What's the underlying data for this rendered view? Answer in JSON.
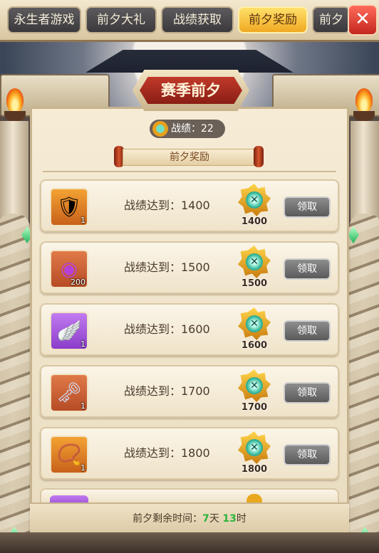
{
  "tabs": [
    {
      "label": "永生者游戏",
      "active": false
    },
    {
      "label": "前夕大礼",
      "active": false
    },
    {
      "label": "战绩获取",
      "active": false
    },
    {
      "label": "前夕奖励",
      "active": true
    },
    {
      "label": "前夕",
      "active": false
    }
  ],
  "close_label": "✕",
  "panel": {
    "title": "赛季前夕",
    "score_label": "战绩：22",
    "section_title": "前夕奖励"
  },
  "rewards": [
    {
      "requirement": "战绩达到：1400",
      "badge_value": "1400",
      "item": "crystal-armor",
      "qty": "1",
      "button": "领取"
    },
    {
      "requirement": "战绩达到：1500",
      "badge_value": "1500",
      "item": "pearl-orb",
      "qty": "200",
      "button": "领取"
    },
    {
      "requirement": "战绩达到：1600",
      "badge_value": "1600",
      "item": "blue-wings",
      "qty": "1",
      "button": "领取"
    },
    {
      "requirement": "战绩达到：1700",
      "badge_value": "1700",
      "item": "bone-key",
      "qty": "1",
      "button": "领取"
    },
    {
      "requirement": "战绩达到：1800",
      "badge_value": "1800",
      "item": "pendant-necklace",
      "qty": "1",
      "button": "领取"
    }
  ],
  "footer": {
    "prefix": "前夕剩余时间：",
    "days": "7",
    "days_unit": "天",
    "hours": "13",
    "hours_unit": "时"
  },
  "colors": {
    "tab_active": "#f0a922",
    "claim_disabled": "#6f6f6f",
    "countdown_green": "#2db43c"
  }
}
